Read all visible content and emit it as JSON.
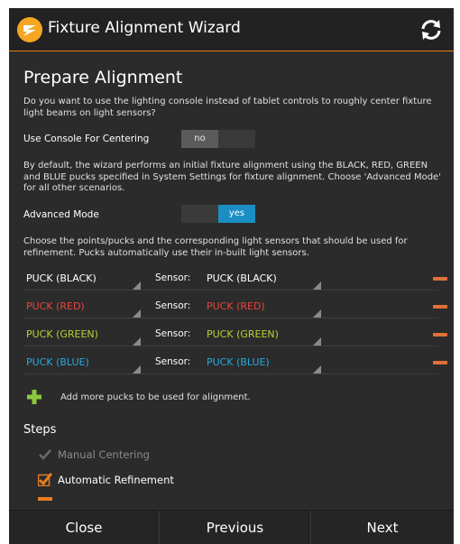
{
  "header": {
    "title": "Fixture Alignment Wizard"
  },
  "section_title": "Prepare Alignment",
  "console_question": "Do you want to use the lighting console instead of tablet controls to roughly center fixture light beams on light sensors?",
  "use_console": {
    "label": "Use Console For Centering",
    "value": "no"
  },
  "default_text": "By default, the wizard performs an initial fixture alignment using the BLACK, RED, GREEN and BLUE pucks specified in System Settings for fixture alignment. Choose 'Advanced Mode' for all other scenarios.",
  "advanced_mode": {
    "label": "Advanced Mode",
    "value": "yes"
  },
  "choose_text": "Choose the points/pucks and the corresponding light sensors that should be used for refinement. Pucks automatically use their in-built light sensors.",
  "sensor_label": "Sensor:",
  "pucks": [
    {
      "puck": "PUCK (BLACK)",
      "sensor": "PUCK (BLACK)",
      "color": "#ffffff"
    },
    {
      "puck": "PUCK (RED)",
      "sensor": "PUCK (RED)",
      "color": "#e8453c"
    },
    {
      "puck": "PUCK (GREEN)",
      "sensor": "PUCK (GREEN)",
      "color": "#b5d334"
    },
    {
      "puck": "PUCK (BLUE)",
      "sensor": "PUCK (BLUE)",
      "color": "#29a9e0"
    }
  ],
  "add_pucks_label": "Add more pucks to be used for alignment.",
  "steps": {
    "title": "Steps",
    "items": [
      {
        "label": "Manual Centering",
        "checked": true,
        "enabled": false
      },
      {
        "label": "Automatic Refinement",
        "checked": true,
        "enabled": true
      }
    ]
  },
  "footer": {
    "close": "Close",
    "previous": "Previous",
    "next": "Next"
  },
  "colors": {
    "accent": "#e67e22",
    "toggle_on": "#1b8fc4",
    "remove": "#e0703a",
    "add": "#8cc63f"
  }
}
